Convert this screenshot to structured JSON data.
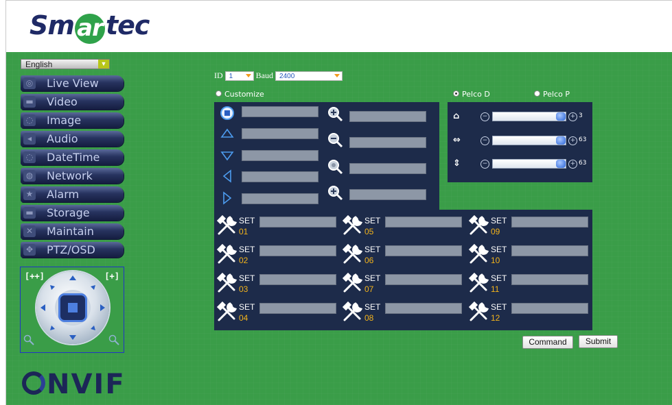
{
  "brand": {
    "logo_pre": "Sm",
    "logo_mid": "ar",
    "logo_post": "tec",
    "footer_logo": "NVIF"
  },
  "language": {
    "selected": "English"
  },
  "menu": [
    {
      "label": "Live View",
      "icon": "eye-icon"
    },
    {
      "label": "Video",
      "icon": "camera-icon"
    },
    {
      "label": "Image",
      "icon": "image-icon"
    },
    {
      "label": "Audio",
      "icon": "speaker-icon"
    },
    {
      "label": "DateTime",
      "icon": "clock-icon"
    },
    {
      "label": "Network",
      "icon": "globe-icon"
    },
    {
      "label": "Alarm",
      "icon": "alarm-icon"
    },
    {
      "label": "Storage",
      "icon": "storage-icon"
    },
    {
      "label": "Maintain",
      "icon": "tools-icon"
    },
    {
      "label": "PTZ/OSD",
      "icon": "ptz-icon"
    }
  ],
  "ptz_control": {
    "zoom_in_label": "[++]",
    "zoom_out_label": "[+]"
  },
  "settings": {
    "id_label": "ID",
    "id_value": "1",
    "baud_label": "Baud",
    "baud_value": "2400",
    "customize_label": "Customize",
    "pelco_d_label": "Pelco D",
    "pelco_p_label": "Pelco P",
    "protocol_selected": "Pelco D"
  },
  "sliders": [
    {
      "name": "home",
      "icon": "home-icon",
      "value": "3",
      "level": 1.0
    },
    {
      "name": "pan-speed",
      "icon": "horizontal-arrows-icon",
      "value": "63",
      "level": 1.0
    },
    {
      "name": "tilt-speed",
      "icon": "vertical-arrows-icon",
      "value": "63",
      "level": 1.0
    }
  ],
  "presets": [
    {
      "label": "SET",
      "num": "01"
    },
    {
      "label": "SET",
      "num": "02"
    },
    {
      "label": "SET",
      "num": "03"
    },
    {
      "label": "SET",
      "num": "04"
    },
    {
      "label": "SET",
      "num": "05"
    },
    {
      "label": "SET",
      "num": "06"
    },
    {
      "label": "SET",
      "num": "07"
    },
    {
      "label": "SET",
      "num": "08"
    },
    {
      "label": "SET",
      "num": "09"
    },
    {
      "label": "SET",
      "num": "10"
    },
    {
      "label": "SET",
      "num": "11"
    },
    {
      "label": "SET",
      "num": "12"
    }
  ],
  "buttons": {
    "command": "Command",
    "submit": "Submit"
  }
}
